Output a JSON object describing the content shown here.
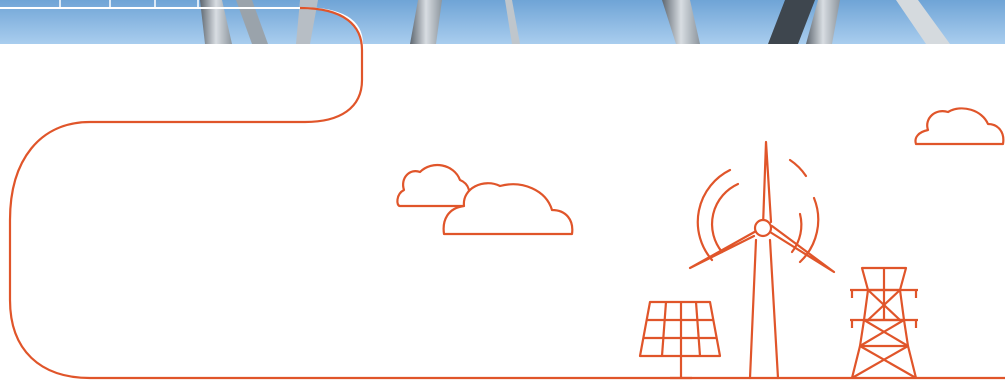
{
  "colors": {
    "line": "#e0552a",
    "sky_top": "#6fa4d6",
    "sky_bottom": "#a9cdee",
    "tower": "#c9ced4",
    "tower_shadow": "#5e6770",
    "background": "#ffffff"
  },
  "icons": [
    "sky-photo-banner",
    "swirl-line-icon",
    "cloud-icon",
    "wind-turbine-icon",
    "solar-panel-icon",
    "power-pylon-icon"
  ]
}
